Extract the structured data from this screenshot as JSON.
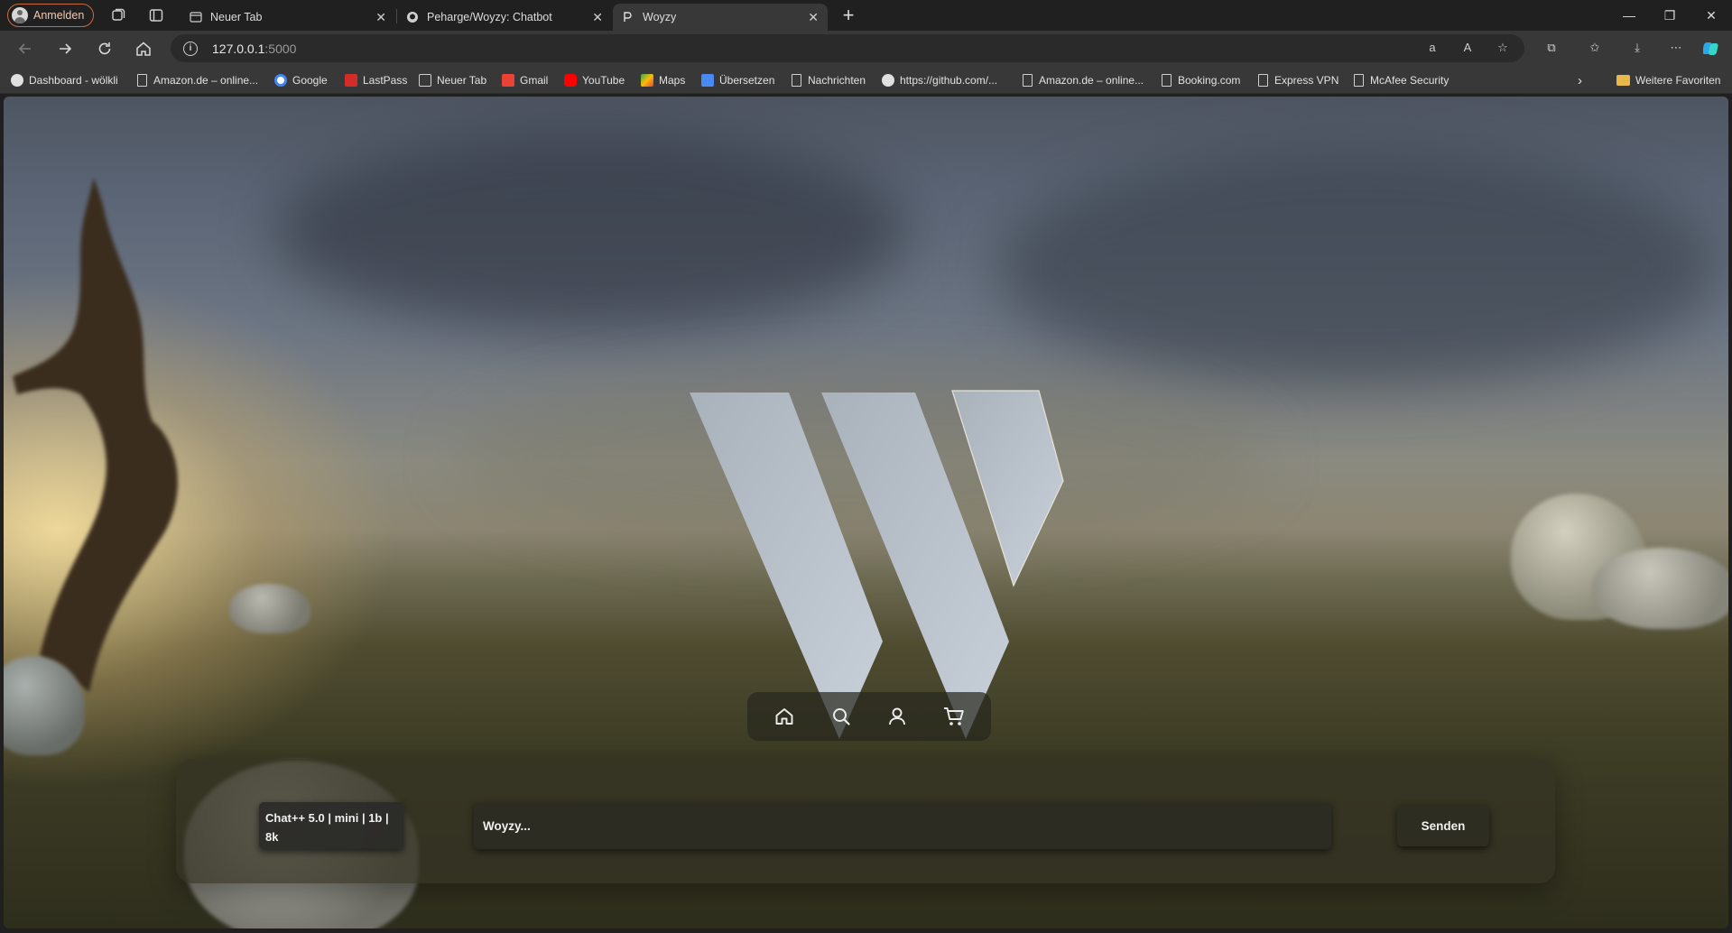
{
  "browser": {
    "profile_label": "Anmelden",
    "tabs": [
      {
        "title": "Neuer Tab",
        "favicon": "page-icon"
      },
      {
        "title": "Peharge/Woyzy: Chatbot",
        "favicon": "github-icon"
      },
      {
        "title": "Woyzy",
        "favicon": "woyzy-icon"
      }
    ],
    "address": {
      "host": "127.0.0.1",
      "port": ":5000"
    },
    "bookmarks": [
      {
        "label": "Dashboard - wölkli",
        "icon": "cloud-icon"
      },
      {
        "label": "Amazon.de – online...",
        "icon": "page-icon"
      },
      {
        "label": "Google",
        "icon": "google-icon"
      },
      {
        "label": "LastPass",
        "icon": "lastpass-icon"
      },
      {
        "label": "Neuer Tab",
        "icon": "newtab-icon"
      },
      {
        "label": "Gmail",
        "icon": "gmail-icon"
      },
      {
        "label": "YouTube",
        "icon": "youtube-icon"
      },
      {
        "label": "Maps",
        "icon": "maps-icon"
      },
      {
        "label": "Übersetzen",
        "icon": "translate-icon"
      },
      {
        "label": "Nachrichten",
        "icon": "page-icon"
      },
      {
        "label": "https://github.com/...",
        "icon": "github-icon"
      },
      {
        "label": "Amazon.de – online...",
        "icon": "page-icon"
      },
      {
        "label": "Booking.com",
        "icon": "page-icon"
      },
      {
        "label": "Express VPN",
        "icon": "page-icon"
      },
      {
        "label": "McAfee Security",
        "icon": "page-icon"
      }
    ],
    "other_favorites": "Weitere Favoriten"
  },
  "app": {
    "nav_icons": [
      "home-icon",
      "search-icon",
      "user-icon",
      "cart-icon"
    ],
    "model_badge": "Chat++ 5.0 | mini | 1b | 8k",
    "input_placeholder": "Woyzy...",
    "send_label": "Senden"
  },
  "colors": {
    "browser_bg": "#202020",
    "toolbar_bg": "#383838",
    "profile_accent": "#c76a3c",
    "logo_fill": "#b5bcc5"
  }
}
